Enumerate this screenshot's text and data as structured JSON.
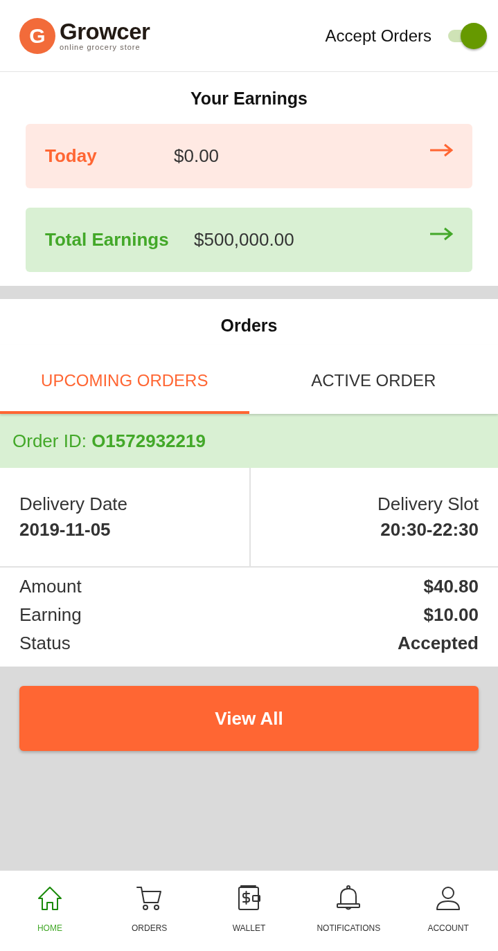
{
  "header": {
    "logo_mark": "G",
    "brand": "Growcer",
    "tagline": "online grocery store",
    "toggle_label": "Accept Orders",
    "accept_orders": true
  },
  "earnings": {
    "title": "Your Earnings",
    "cards": [
      {
        "label": "Today",
        "amount": "$0.00",
        "kind": "today"
      },
      {
        "label": "Total Earnings",
        "amount": "$500,000.00",
        "kind": "total"
      }
    ]
  },
  "orders": {
    "title": "Orders",
    "tabs": [
      {
        "label": "UPCOMING ORDERS",
        "selected": true
      },
      {
        "label": "ACTIVE ORDER",
        "selected": false
      }
    ],
    "order": {
      "id_line": "Order ID: **O1572932219**",
      "date_label": "Delivery Date",
      "date": "2019-11-05",
      "slot_label": "Delivery Slot",
      "slot": "20:30-22:30",
      "rows": [
        {
          "label": "Amount",
          "value": "$40.80"
        },
        {
          "label": "Earning",
          "value": "$10.00"
        },
        {
          "label": "Status",
          "value": "Accepted"
        }
      ]
    },
    "button": "View All"
  },
  "nav": [
    {
      "label": "HOME",
      "kind": "home",
      "selected": true
    },
    {
      "label": "ORDERS",
      "kind": "cart",
      "selected": false
    },
    {
      "label": "WALLET",
      "kind": "wallet",
      "selected": false
    },
    {
      "label": "NOTIFICATIONS",
      "kind": "bell",
      "selected": false
    },
    {
      "label": "ACCOUNT",
      "kind": "user",
      "selected": false
    }
  ]
}
